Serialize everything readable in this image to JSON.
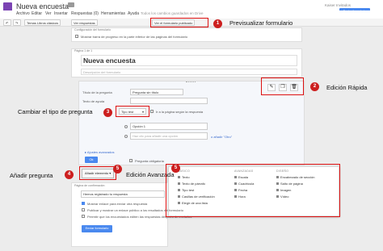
{
  "header": {
    "doc_title": "Nueva encuesta",
    "menu": [
      "Archivo",
      "Editar",
      "Ver",
      "Insertar",
      "Respuestas (0)",
      "Herramientas",
      "Ayuda"
    ],
    "saved_status": "Todos los cambios guardados en Drive",
    "account": "Kaiser Invitados",
    "send_button": "Enviar formulario"
  },
  "toolbar": {
    "themes": "Temas Libros clásicos",
    "view_responses": "Ver respuestas",
    "view_form": "Ver el formulario publicado"
  },
  "settings": {
    "heading": "Configuración del formulario",
    "progress_bar": "Mostrar barra de progreso en la parte inferior de las páginas del formulario"
  },
  "page": {
    "label": "Página 1 de 1",
    "form_title": "Nueva encuesta",
    "form_description": "Descripción del formulario"
  },
  "question": {
    "title_label": "Título de la pregunta",
    "title_value": "Pregunta sin título",
    "help_label": "Texto de ayuda",
    "type_label": "Tipo de pregunta",
    "type_value": "Tipo test",
    "page_nav": "Ir a la página según la respuesta",
    "option_1": "Opción 1",
    "option_2": "Haz clic para añadir una opción",
    "other": "o añadir \"Otro\"",
    "advanced": "Ajustes avanzados",
    "ok": "Ok",
    "required": "Pregunta obligatoria"
  },
  "add_menu": {
    "button": "Añadir elemento",
    "col_basic": "BÁSICO",
    "col_advanced": "AVANZADAS",
    "col_design": "DISEÑO",
    "basic": [
      "Texto",
      "Texto de párrafo",
      "Tipo test",
      "Casillas de verificación",
      "Elegir de una lista"
    ],
    "advanced": [
      "Escala",
      "Cuadrícula",
      "Fecha",
      "Hora"
    ],
    "design": [
      "Encabezado de sección",
      "Salto de página",
      "Imagen",
      "Vídeo"
    ]
  },
  "confirmation": {
    "heading": "Página de confirmación",
    "message": "Hemos registrado tu respuesta",
    "opt1": "Mostrar enlace para enviar otra respuesta",
    "opt2": "Publicar y mostrar un enlace público a los resultados del formulario",
    "opt3": "Permitir que los encuestados editen las respuestas después de enviarlas",
    "send_button": "Enviar formulario"
  },
  "callouts": {
    "preview": "Previsualizar formulario",
    "quick_edit": "Edición Rápida",
    "change_type": "Cambiar el tipo de pregunta",
    "add_question": "Añadir pregunta",
    "advanced_edit": "Edición Avanzada",
    "badges": [
      "1",
      "2",
      "3",
      "4",
      "5",
      "5"
    ]
  },
  "colors": {
    "accent": "#4a89ef",
    "callout_red": "#cc1f1f",
    "toolbar_bg": "#f4f4f4"
  }
}
